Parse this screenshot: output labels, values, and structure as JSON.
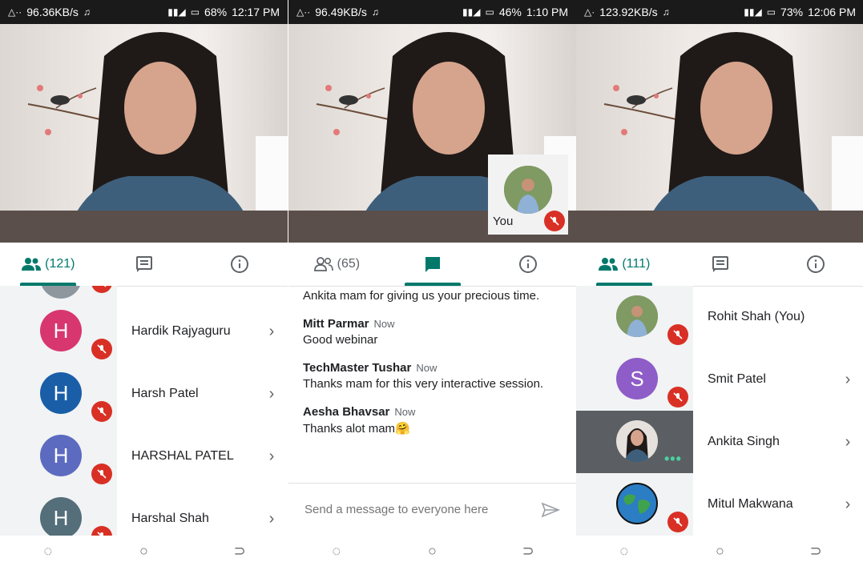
{
  "panels": [
    {
      "status": {
        "net_speed": "96.36KB/s",
        "battery": "68%",
        "time": "12:17 PM"
      },
      "tabs": {
        "people_count": "(121)",
        "active": "people"
      },
      "people": [
        {
          "initial": "",
          "name": "",
          "color": "#8e979e"
        },
        {
          "initial": "H",
          "name": "Hardik Rajyaguru",
          "color": "#d8366f"
        },
        {
          "initial": "H",
          "name": "Harsh Patel",
          "color": "#1a5ea8"
        },
        {
          "initial": "H",
          "name": "HARSHAL PATEL",
          "color": "#5c6bc0"
        },
        {
          "initial": "H",
          "name": "Harshal Shah",
          "color": "#546e7a"
        }
      ]
    },
    {
      "status": {
        "net_speed": "96.49KB/s",
        "battery": "46%",
        "time": "1:10 PM"
      },
      "tabs": {
        "people_count": "(65)",
        "active": "chat"
      },
      "self_label": "You",
      "messages": [
        {
          "sender": "",
          "time": "",
          "text": "Ankita mam for giving us your precious time."
        },
        {
          "sender": "Mitt Parmar",
          "time": "Now",
          "text": "Good webinar"
        },
        {
          "sender": "TechMaster Tushar",
          "time": "Now",
          "text": "Thanks mam for this very interactive session."
        },
        {
          "sender": "Aesha Bhavsar",
          "time": "Now",
          "text": "Thanks alot mam🤗"
        }
      ],
      "input_placeholder": "Send a message to everyone here"
    },
    {
      "status": {
        "net_speed": "123.92KB/s",
        "battery": "73%",
        "time": "12:06 PM"
      },
      "tabs": {
        "people_count": "(111)",
        "active": "people"
      },
      "people": [
        {
          "initial": "",
          "name": "Rohit Shah (You)",
          "color": "#7a8f5a"
        },
        {
          "initial": "S",
          "name": "Smit Patel",
          "color": "#8e5dc8"
        },
        {
          "initial": "",
          "name": "Ankita Singh",
          "color": "#6b6f73"
        },
        {
          "initial": "",
          "name": "Mitul Makwana",
          "color": "#2e8b57"
        }
      ]
    }
  ],
  "colors": {
    "accent": "#00796b",
    "mute": "#d93025"
  }
}
